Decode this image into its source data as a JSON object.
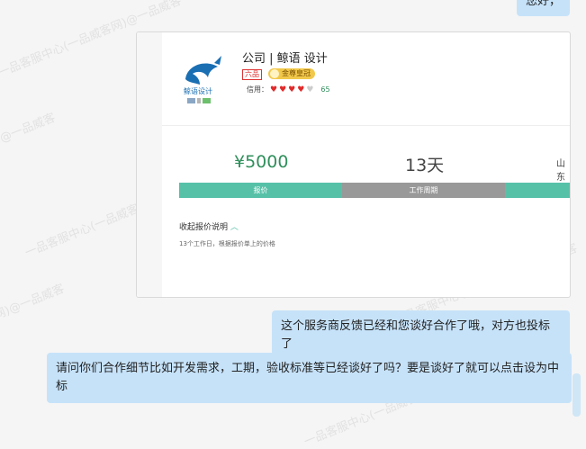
{
  "chat": {
    "top_bubble": "您好，",
    "msg_right": "这个服务商反馈已经和您谈好合作了哦，对方也投标了",
    "msg_left": "请问你们合作细节比如开发需求，工期，验收标准等已经谈好了吗？要是谈好了就可以点击设为中标"
  },
  "card": {
    "company": "公司 | 鲸语 设计",
    "logo_text": "鲸语设计",
    "badge_level": "六品",
    "badge_gold": "金尊皇冠",
    "credit_label": "信用：",
    "credit_score": "65",
    "hearts_filled": 4,
    "hearts_total": 5,
    "price": "¥5000",
    "days": "13天",
    "location": "山东",
    "bar_labels": [
      "报价",
      "工作周期",
      ""
    ],
    "quote_title": "收起报价说明",
    "quote_detail": "13个工作日，根据报价单上的价格"
  },
  "watermark_text": "一品客服中心(一品威客网)@一品威客",
  "colors": {
    "bubble": "#c6e2f9",
    "teal": "#57c1a8",
    "grey_bar": "#999999",
    "price_green": "#2f8f5b",
    "heart_red": "#e02a2a"
  }
}
